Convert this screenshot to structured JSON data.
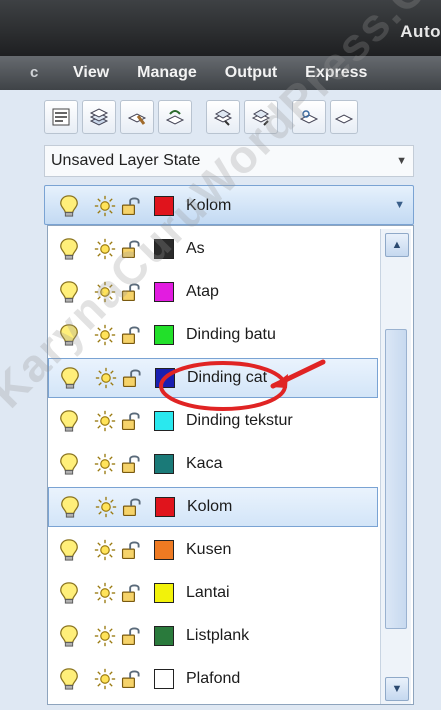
{
  "window": {
    "title": "Auto"
  },
  "menu": {
    "left_fragment": "c",
    "items": [
      "View",
      "Manage",
      "Output",
      "Express"
    ]
  },
  "layer_state": {
    "value": "Unsaved Layer State"
  },
  "current_layer": {
    "name": "Kolom",
    "color": "#e0141c"
  },
  "layers": [
    {
      "name": "As",
      "color": "#2a2a2a",
      "selected": false
    },
    {
      "name": "Atap",
      "color": "#e21ce0",
      "selected": false
    },
    {
      "name": "Dinding batu",
      "color": "#22e02a",
      "selected": false
    },
    {
      "name": "Dinding cat",
      "color": "#1a1fb0",
      "selected": true
    },
    {
      "name": "Dinding tekstur",
      "color": "#2ae8ee",
      "selected": false
    },
    {
      "name": "Kaca",
      "color": "#1a7a78",
      "selected": false
    },
    {
      "name": "Kolom",
      "color": "#e0141c",
      "selected": true
    },
    {
      "name": "Kusen",
      "color": "#ee7a22",
      "selected": false
    },
    {
      "name": "Lantai",
      "color": "#f2f20a",
      "selected": false
    },
    {
      "name": "Listplank",
      "color": "#2a7a3c",
      "selected": false
    },
    {
      "name": "Plafond",
      "color": "#ffffff",
      "selected": false
    }
  ],
  "watermark": "KarynaCuruWordPress.Com",
  "accent": "#e02424",
  "icons": [
    "layer-properties-icon",
    "layer-states-icon",
    "layer-match-icon",
    "layer-previous-icon",
    "layer-isolate-icon",
    "layer-unisolate-icon",
    "layer-freeze-icon",
    "layer-off-icon"
  ]
}
